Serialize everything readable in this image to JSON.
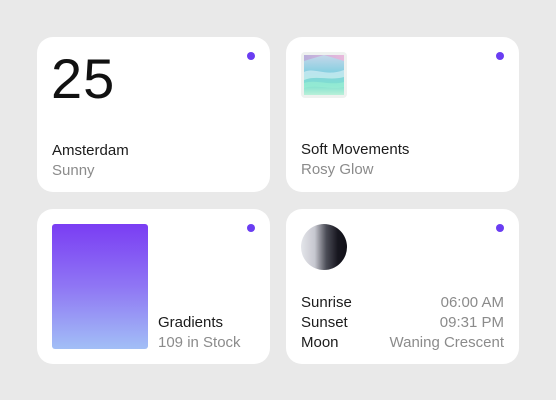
{
  "colors": {
    "background": "#e9e9e9",
    "card": "#ffffff",
    "accent": "#6a3df2",
    "muted_text": "#8b8b8b"
  },
  "weather": {
    "temperature": "25",
    "city": "Amsterdam",
    "condition": "Sunny"
  },
  "music": {
    "artwork_icon": "album-art",
    "title": "Soft Movements",
    "artist": "Rosy Glow"
  },
  "product": {
    "swatch_icon": "gradient-swatch",
    "name": "Gradients",
    "stock": "109 in Stock"
  },
  "sun": {
    "moon_icon": "waning-crescent-moon",
    "rows": [
      {
        "label": "Sunrise",
        "value": "06:00 AM"
      },
      {
        "label": "Sunset",
        "value": "09:31 PM"
      },
      {
        "label": "Moon",
        "value": "Waning Crescent"
      }
    ]
  }
}
